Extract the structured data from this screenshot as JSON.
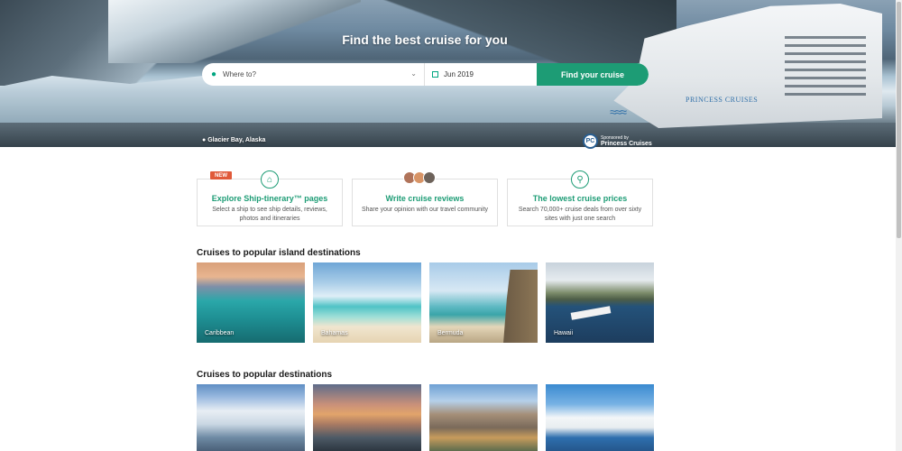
{
  "hero": {
    "title": "Find the best cruise for you",
    "caption": "Glacier Bay, Alaska",
    "ship_text": "PRINCESS CRUISES",
    "sponsor": {
      "line1": "Sponsored by",
      "line2": "Princess Cruises"
    }
  },
  "search": {
    "where_placeholder": "Where to?",
    "date_value": "Jun 2019",
    "button_label": "Find your cruise"
  },
  "features": [
    {
      "badge": "NEW",
      "title": "Explore Ship-tinerary™ pages",
      "desc": "Select a ship to see ship details, reviews, photos and itineraries"
    },
    {
      "title": "Write cruise reviews",
      "desc": "Share your opinion with our travel community"
    },
    {
      "title": "The lowest cruise prices",
      "desc": "Search 70,000+ cruise deals from over sixty sites with just one search"
    }
  ],
  "island_section": {
    "title": "Cruises to popular island destinations",
    "items": [
      "Caribbean",
      "Bahamas",
      "Bermuda",
      "Hawaii"
    ]
  },
  "destinations_section": {
    "title": "Cruises to popular destinations"
  },
  "colors": {
    "accent": "#1d9c75",
    "new_badge": "#e05a3a"
  }
}
